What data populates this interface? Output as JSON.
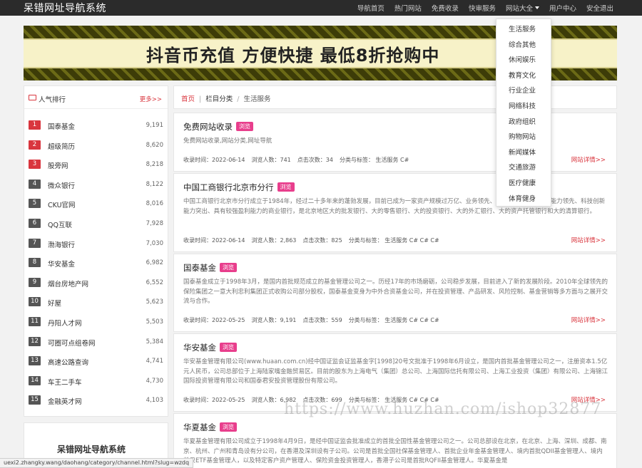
{
  "site_title": "呆错网址导航系统",
  "nav": [
    "导航首页",
    "热门网站",
    "免费收录",
    "快审服务",
    "网站大全",
    "用户中心",
    "安全退出"
  ],
  "banner_text": "抖音币充值 方便快捷 最低8折抢购中",
  "dropdown": [
    "生活服务",
    "综合其他",
    "休闲娱乐",
    "教育文化",
    "行业企业",
    "网络科技",
    "政府组织",
    "购物网站",
    "新闻媒体",
    "交通旅游",
    "医疗健康",
    "体育健身"
  ],
  "rank": {
    "title": "人气排行",
    "more": "更多>>",
    "items": [
      {
        "n": "1",
        "name": "国泰基金",
        "count": "9,191"
      },
      {
        "n": "2",
        "name": "超级简历",
        "count": "8,620"
      },
      {
        "n": "3",
        "name": "股旁网",
        "count": "8,218"
      },
      {
        "n": "4",
        "name": "微众银行",
        "count": "8,122"
      },
      {
        "n": "5",
        "name": "CKU官网",
        "count": "8,016"
      },
      {
        "n": "6",
        "name": "QQ互联",
        "count": "7,928"
      },
      {
        "n": "7",
        "name": "渤海银行",
        "count": "7,030"
      },
      {
        "n": "8",
        "name": "华安基金",
        "count": "6,982"
      },
      {
        "n": "9",
        "name": "烟台房地产网",
        "count": "6,552"
      },
      {
        "n": "10",
        "name": "好屋",
        "count": "5,623"
      },
      {
        "n": "11",
        "name": "丹阳人才网",
        "count": "5,503"
      },
      {
        "n": "12",
        "name": "可圈可点组卷网",
        "count": "5,384"
      },
      {
        "n": "13",
        "name": "高速公路查询",
        "count": "4,741"
      },
      {
        "n": "14",
        "name": "车王二手车",
        "count": "4,730"
      },
      {
        "n": "15",
        "name": "金融英才网",
        "count": "4,103"
      }
    ]
  },
  "brandbox_title": "呆错网址导航系统",
  "breadcrumb": {
    "home": "首页",
    "mid": "栏目分类",
    "cur": "生活服务"
  },
  "tag_label": "浏览",
  "detail_label": "网站详情>>",
  "cards": [
    {
      "title": "免费网站收录",
      "desc": "免费网站收录,网站分类,网址导航",
      "time": "收录时间：2022-06-14",
      "views": "浏览人数：741",
      "clicks": "点击次数：34",
      "cat": "分类与标签： 生活服务 C#"
    },
    {
      "title": "中国工商银行北京市分行",
      "desc": "中国工商银行北京市分行成立于1984年，经过二十多年来的蓬勃发展，目前已成为一家资产规模过万亿、业务领先、综合实力雄厚、管理能力领先、科技创新能力突出、具有较强盈利能力的商业银行，是北京地区大的批发银行、大的零售银行、大的投资银行、大的外汇银行、大的资产托管银行和大的清算银行。",
      "time": "收录时间：2022-06-14",
      "views": "浏览人数：2,863",
      "clicks": "点击次数：825",
      "cat": "分类与标签： 生活服务 C# C# C#"
    },
    {
      "title": "国泰基金",
      "desc": "国泰基金成立于1998年3月，是国内首批规范成立的基金管理公司之一。历经17年的市场磨砺，公司稳步发展，目前进入了新的发展阶段。2010年全球领先的保险集团之一意大利忠利集团正式收购公司部分股权，国泰基金变身为中外合资基金公司，并在投资管理、产品研发、风险控制、基金营销等多方面与之展开交流与合作。",
      "time": "收录时间：2022-05-25",
      "views": "浏览人数：9,191",
      "clicks": "点击次数：559",
      "cat": "分类与标签： 生活服务 C# C# C#"
    },
    {
      "title": "华安基金",
      "desc": "华安基金管理有限公司(www.huaan.com.cn)经中国证监会证监基金字[1998]20号文批准于1998年6月设立，是国内首批基金管理公司之一，注册资本1.5亿元人民币，公司总部位于上海陆家嘴金融贸易区。目前的股东为上海电气（集团）总公司、上海国际信托有限公司、上海工业投资（集团）有限公司、上海锦江国际投资管理有限公司和国泰君安投资管理股份有限公司。",
      "time": "收录时间：2022-05-25",
      "views": "浏览人数：6,982",
      "clicks": "点击次数：699",
      "cat": "分类与标签： 生活服务 C# C# C#"
    },
    {
      "title": "华夏基金",
      "desc": "华夏基金管理有限公司成立于1998年4月9日，是经中国证监会批准成立的首批全国性基金管理公司之一。公司总部设在北京，在北京、上海、深圳、成都、南京、杭州、广州和青岛设有分公司，在香港及深圳设有子公司。公司是首批全国社保基金管理人、首批企业年金基金管理人、境内首批QDII基金管理人、境内首只ETF基金管理人，以及特定客户资产管理人、保险资金投资管理人，香港子公司是首批RQFII基金管理人。华夏基金是",
      "time": "",
      "views": "",
      "clicks": "",
      "cat": ""
    }
  ],
  "watermark": "https://www.huzhan.com/ishop32877",
  "status_url": "uexi2.zhangky.wang/daohang/category/channel.html?slug=wzdq"
}
